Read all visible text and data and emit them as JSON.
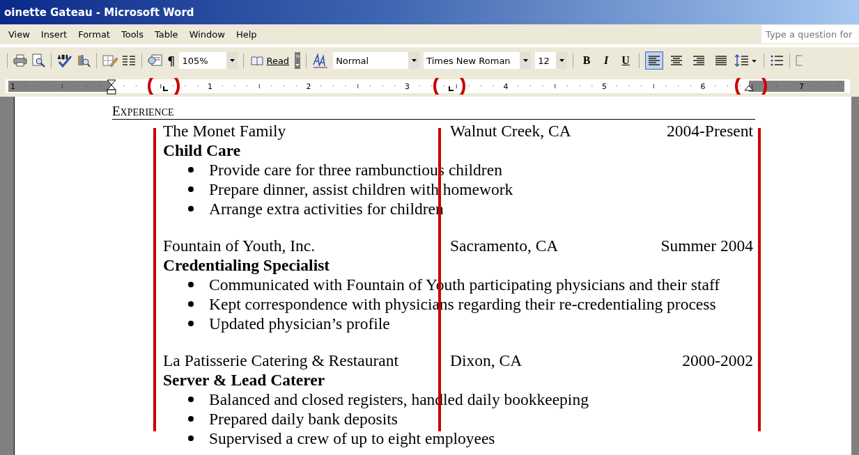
{
  "window": {
    "title": "oinette Gateau - Microsoft Word"
  },
  "menu": [
    "View",
    "Insert",
    "Format",
    "Tools",
    "Table",
    "Window",
    "Help"
  ],
  "help_search": {
    "placeholder": "Type a question for"
  },
  "toolbar": {
    "pilcrow": "¶",
    "zoom": "105%",
    "read": "Read",
    "style": "Normal",
    "font": "Times New Roman",
    "size": "12",
    "format_buttons": [
      {
        "label": "B",
        "kind": "bold"
      },
      {
        "label": "I",
        "kind": "italic"
      },
      {
        "label": "U",
        "kind": "underline"
      }
    ],
    "align_buttons": [
      {
        "kind": "left",
        "selected": true
      },
      {
        "kind": "center",
        "selected": false
      },
      {
        "kind": "right",
        "selected": false
      },
      {
        "kind": "justify",
        "selected": false
      }
    ]
  },
  "ruler": {
    "labels": [
      "1",
      "1",
      "2",
      "3",
      "4",
      "5",
      "6",
      "7"
    ]
  },
  "document": {
    "heading": "EXPERIENCE",
    "jobs": [
      {
        "employer": "The Monet Family",
        "location": "Walnut Creek, CA",
        "dates": "2004-Present",
        "title": "Child Care",
        "bullets": [
          "Provide care for three rambunctious children",
          "Prepare dinner, assist children with homework",
          "Arrange extra activities for children"
        ]
      },
      {
        "employer": "Fountain of Youth, Inc.",
        "location": "Sacramento, CA",
        "dates": "Summer 2004",
        "title": "Credentialing Specialist",
        "bullets": [
          "Communicated with Fountain of Youth participating physicians and their staff",
          "Kept correspondence with physicians regarding their re-credentialing process",
          "Updated physician’s profile"
        ]
      },
      {
        "employer": "La Patisserie Catering & Restaurant",
        "location": "Dixon, CA",
        "dates": "2000-2002",
        "title": "Server & Lead Caterer",
        "bullets": [
          "Balanced and closed registers, handled daily bookkeeping",
          "Prepared daily bank deposits",
          "Supervised a crew of up to eight employees"
        ]
      }
    ]
  }
}
